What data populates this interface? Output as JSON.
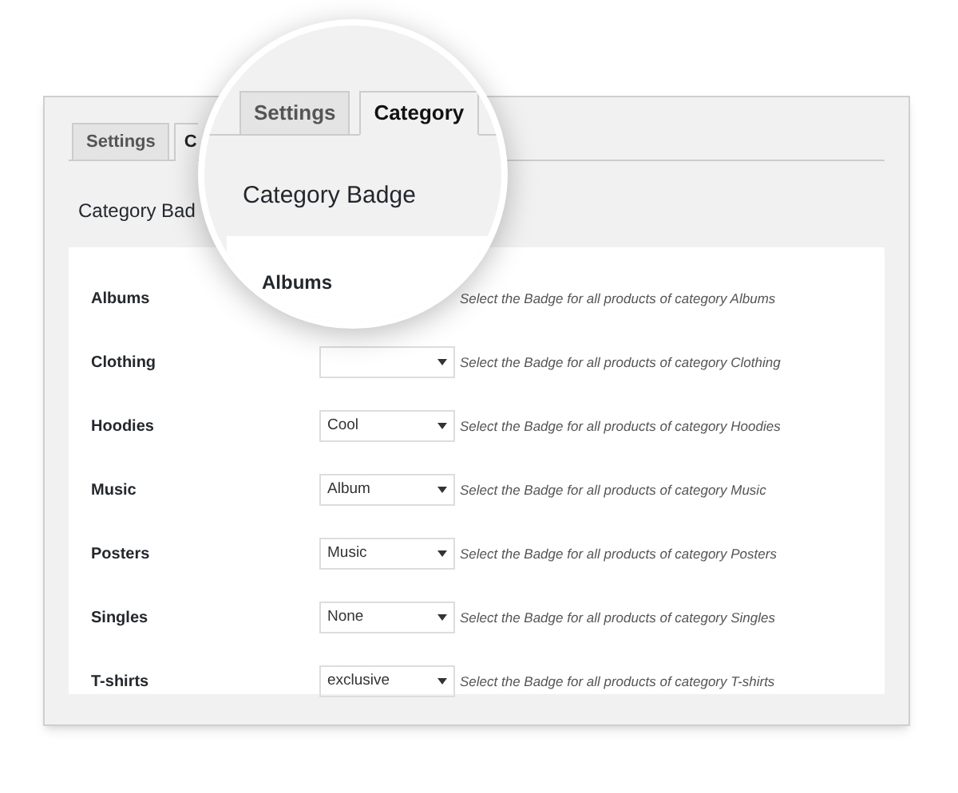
{
  "tabs": [
    {
      "label": "Settings",
      "selected": false
    },
    {
      "label": "C",
      "selected": true
    }
  ],
  "heading": "Category Bad",
  "rows": [
    {
      "kind": "label",
      "label": "Albums",
      "description": "Select the Badge for all products of category Albums"
    },
    {
      "kind": "select",
      "label": "Clothing",
      "description": "Select the Badge for all products of category Clothing"
    },
    {
      "kind": "select",
      "label": "Hoodies",
      "value": "Cool",
      "description": "Select the Badge for all products of category Hoodies"
    },
    {
      "kind": "select",
      "label": "Music",
      "value": "Album",
      "description": "Select the Badge for all products of category Music"
    },
    {
      "kind": "select",
      "label": "Posters",
      "value": "Music",
      "description": "Select the Badge for all products of category Posters"
    },
    {
      "kind": "select",
      "label": "Singles",
      "value": "None",
      "description": "Select the Badge for all products of category Singles"
    },
    {
      "kind": "select",
      "label": "T-shirts",
      "value": "exclusive",
      "description": "Select the Badge for all products of category T-shirts"
    }
  ],
  "magnifier": {
    "tabs": [
      {
        "label": "Settings",
        "selected": false
      },
      {
        "label": "Category",
        "selected": true
      }
    ],
    "heading": "Category Badge",
    "row_label": "Albums"
  }
}
